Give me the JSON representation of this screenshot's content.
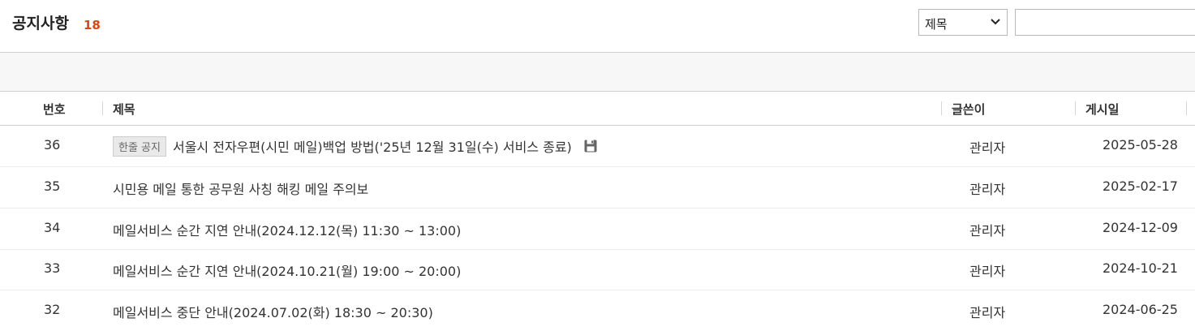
{
  "header": {
    "title": "공지사항",
    "count": "18"
  },
  "search": {
    "field_selected": "제목",
    "query": ""
  },
  "columns": {
    "number": "번호",
    "subject": "제목",
    "author": "글쓴이",
    "date": "게시일"
  },
  "rows": [
    {
      "number": "36",
      "badge": "한줄 공지",
      "subject": "서울시 전자우편(시민 메일)백업 방법('25년 12월 31일(수) 서비스 종료)",
      "author": "관리자",
      "date": "2025-05-28",
      "attachment": "floppy-disk-icon"
    },
    {
      "number": "35",
      "subject": "시민용 메일 통한 공무원 사칭 해킹 메일 주의보",
      "author": "관리자",
      "date": "2025-02-17"
    },
    {
      "number": "34",
      "subject": "메일서비스 순간 지연 안내(2024.12.12(목) 11:30 ~ 13:00)",
      "author": "관리자",
      "date": "2024-12-09"
    },
    {
      "number": "33",
      "subject": "메일서비스 순간 지연 안내(2024.10.21(월) 19:00 ~ 20:00)",
      "author": "관리자",
      "date": "2024-10-21"
    },
    {
      "number": "32",
      "subject": "메일서비스 중단 안내(2024.07.02(화) 18:30 ~ 20:30)",
      "author": "관리자",
      "date": "2024-06-25"
    }
  ],
  "colors": {
    "count": "#d9480f",
    "border": "#cfcfcf",
    "toolbar_bg": "#f7f7f7"
  }
}
